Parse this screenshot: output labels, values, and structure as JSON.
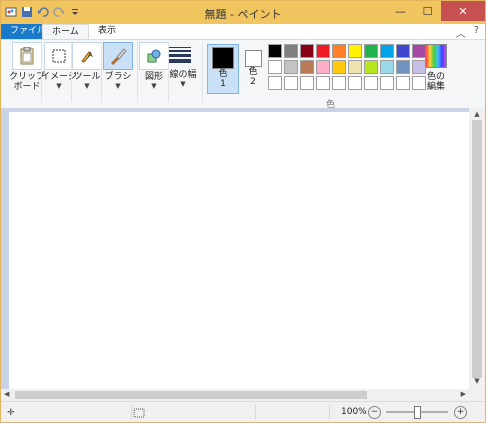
{
  "window": {
    "title": "無題 - ペイント",
    "controls": {
      "minimize": "—",
      "maximize": "☐",
      "close": "✕"
    }
  },
  "quick_access": {
    "items": [
      "paint-app-icon",
      "save-icon",
      "undo-icon",
      "redo-icon",
      "customize-icon"
    ]
  },
  "tabs": [
    {
      "label": "ファイル"
    },
    {
      "label": "ホーム"
    },
    {
      "label": "表示"
    }
  ],
  "ribbon": {
    "clipboard": {
      "label": "クリップ",
      "label2": "ボード"
    },
    "image": {
      "label": "イメージ"
    },
    "tools": {
      "label": "ツール"
    },
    "brushes": {
      "label": "ブラシ"
    },
    "shapes": {
      "label": "図形"
    },
    "size": {
      "label": "線の幅"
    },
    "color1": {
      "label": "色",
      "num": "1",
      "value": "#000000"
    },
    "color2": {
      "label": "色",
      "num": "2",
      "value": "#ffffff"
    },
    "edit_colors": {
      "label": "色の",
      "label2": "編集"
    },
    "colors_group_label": "色"
  },
  "palette": [
    "#000000",
    "#7f7f7f",
    "#880015",
    "#ed1c24",
    "#ff7f27",
    "#fff200",
    "#22b14c",
    "#00a2e8",
    "#3f48cc",
    "#a349a4",
    "#ffffff",
    "#c3c3c3",
    "#b97a57",
    "#ffaec9",
    "#ffc90e",
    "#efe4b0",
    "#b5e61d",
    "#99d9ea",
    "#7092be",
    "#c8bfe7",
    "#ffffff",
    "#ffffff",
    "#ffffff",
    "#ffffff",
    "#ffffff",
    "#ffffff",
    "#ffffff",
    "#ffffff",
    "#ffffff",
    "#ffffff"
  ],
  "status": {
    "zoom": "100%",
    "zoom_fraction": 0.5
  },
  "colors": {
    "titlebar": "#f0c560",
    "file_tab": "#1979ca",
    "close_button": "#c75050",
    "canvas_bg": "#c8d4e5"
  }
}
